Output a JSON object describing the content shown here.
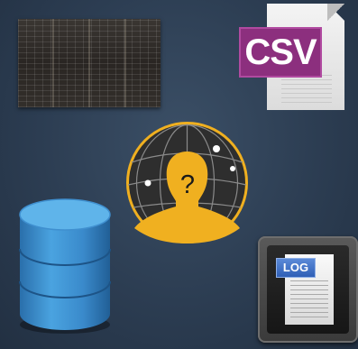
{
  "icons": {
    "spreadsheet": "spreadsheet-thumbnail",
    "csv": "csv-file-icon",
    "user": "unknown-user-globe-icon",
    "database": "database-icon",
    "log": "log-file-icon"
  },
  "csv_badge": "CSV",
  "user_unknown_mark": "?",
  "log_badge": "LOG",
  "colors": {
    "background": "#2c3d52",
    "csv_badge": "#8c2f7e",
    "user_globe": "#f0b020",
    "database": "#3f8fcf",
    "log_badge": "#2f5fb6"
  }
}
